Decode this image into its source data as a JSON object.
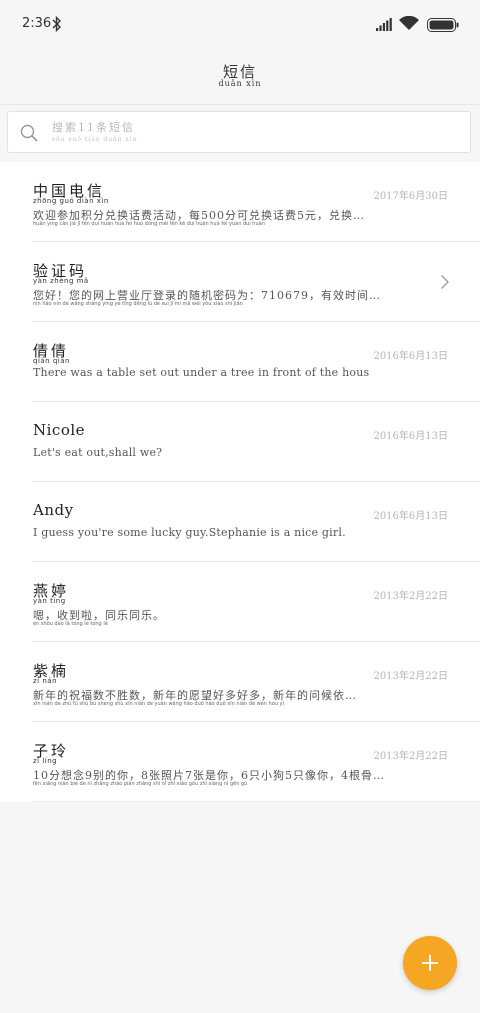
{
  "status": {
    "time": "2:36"
  },
  "header": {
    "title": "短信",
    "title_pinyin": "duǎn xìn"
  },
  "search": {
    "placeholder": "搜索11条短信",
    "placeholder_pinyin": "sōu suǒ  tiáo duǎn xìn"
  },
  "messages": [
    {
      "name": "中国电信",
      "name_pinyin": "zhōng guó diàn xìn",
      "date": "2017年6月30日",
      "preview": "欢迎参加积分兑换话费活动，每500分可兑换话费5元，兑换…",
      "preview_pinyin": "huān yíng cān jiā jī fēn duì huàn huà fèi huó dòng  měi  fēn kě duì huàn huà fèi  yuán duì huàn"
    },
    {
      "name": "验证码",
      "name_pinyin": "yàn zhèng mǎ",
      "date": "",
      "preview": "您好！您的网上营业厅登录的随机密码为：710679，有效时间…",
      "preview_pinyin": "nín hǎo  nín de wǎng shàng yíng yè tīng dēng lù de suí jī mì mǎ wéi  yǒu xiào shí jiān"
    },
    {
      "name": "倩倩",
      "name_pinyin": "qiàn qiàn",
      "date": "2016年6月13日",
      "preview": "There was a table set out under a tree in front of the hous",
      "preview_pinyin": ""
    },
    {
      "name": "Nicole",
      "name_pinyin": "",
      "date": "2016年6月13日",
      "preview": "Let's eat out,shall we?",
      "preview_pinyin": ""
    },
    {
      "name": "Andy",
      "name_pinyin": "",
      "date": "2016年6月13日",
      "preview": "I guess you're some lucky guy.Stephanie is a nice girl.",
      "preview_pinyin": ""
    },
    {
      "name": "燕婷",
      "name_pinyin": "yàn tíng",
      "date": "2013年2月22日",
      "preview": "嗯，收到啦，同乐同乐。",
      "preview_pinyin": "èn  shōu dào lā  tóng lè tóng lè"
    },
    {
      "name": "紫楠",
      "name_pinyin": "zǐ nán",
      "date": "2013年2月22日",
      "preview": "新年的祝福数不胜数，新年的愿望好多好多，新年的问候依…",
      "preview_pinyin": "xīn nián de zhù fú shù bù shèng shù  xīn nián de yuàn wàng hǎo duō hǎo duō  xīn nián de wèn hòu yī"
    },
    {
      "name": "子玲",
      "name_pinyin": "zǐ líng",
      "date": "2013年2月22日",
      "preview": "10分想念9别的你，8张照片7张是你，6只小狗5只像你，4根骨…",
      "preview_pinyin": "fēn xiǎng niàn  bié de nǐ  zhāng zhào piàn  zhāng shì nǐ  zhī xiǎo gǒu  zhī xiàng nǐ  gēn gǔ"
    }
  ],
  "fab": {
    "icon": "plus-icon",
    "color": "#f5a623"
  },
  "colors": {
    "accent": "#f5a623",
    "background": "#f6f6f6"
  }
}
